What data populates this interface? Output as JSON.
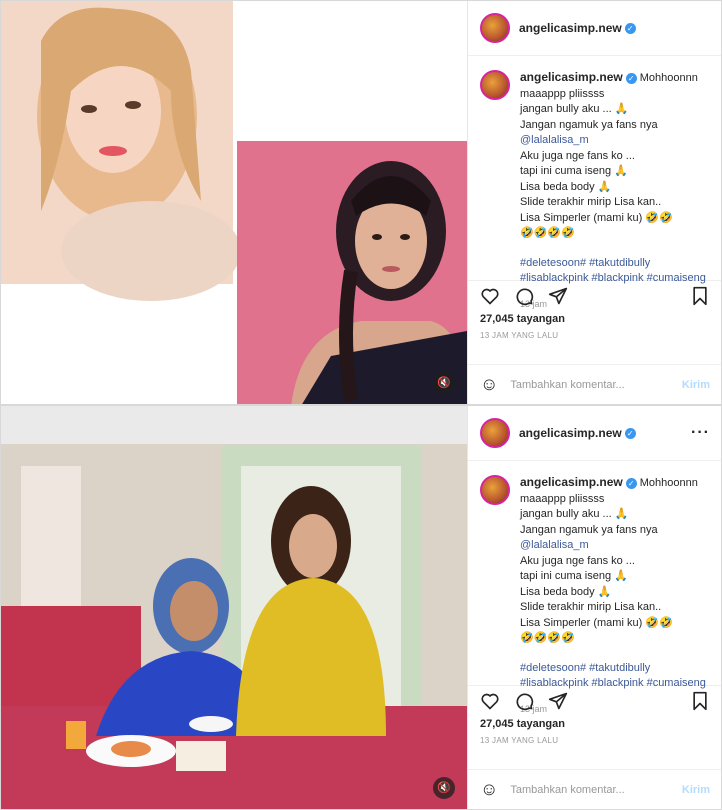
{
  "posts": [
    {
      "username": "angelicasimp.new",
      "caption_lines": [
        "maaappp pliissss",
        "jangan bully aku ... 🙏",
        "Jangan ngamuk ya fans nya"
      ],
      "caption_first": "Mohhoonnn",
      "mention": "@lalalalisa_m",
      "caption_lines2": [
        "Aku juga nge fans ko ...",
        "tapi ini cuma iseng 🙏",
        "Lisa beda body 🙏",
        "Slide terakhir mirip Lisa kan..",
        "Lisa Simperler (mami ku) 🤣🤣",
        "🤣🤣🤣🤣"
      ],
      "hashtags_line1": "#deletesoon# #takutdibully",
      "hashtags_line2": "#lisablackpink #blackpink #cumaiseng",
      "time": "13 jam",
      "views": "27,045 tayangan",
      "ago": "13 JAM YANG LALU",
      "comment_placeholder": "Tambahkan komentar...",
      "send": "Kirim"
    }
  ],
  "icons": [
    "heart-icon",
    "comment-icon",
    "share-icon",
    "bookmark-icon",
    "mute-icon",
    "verified-icon",
    "more-icon",
    "emoji-icon"
  ],
  "colors": {
    "link": "#3b5998",
    "verified": "#3897f0",
    "send_disabled": "#b3dbff",
    "muted_text": "#999999"
  }
}
